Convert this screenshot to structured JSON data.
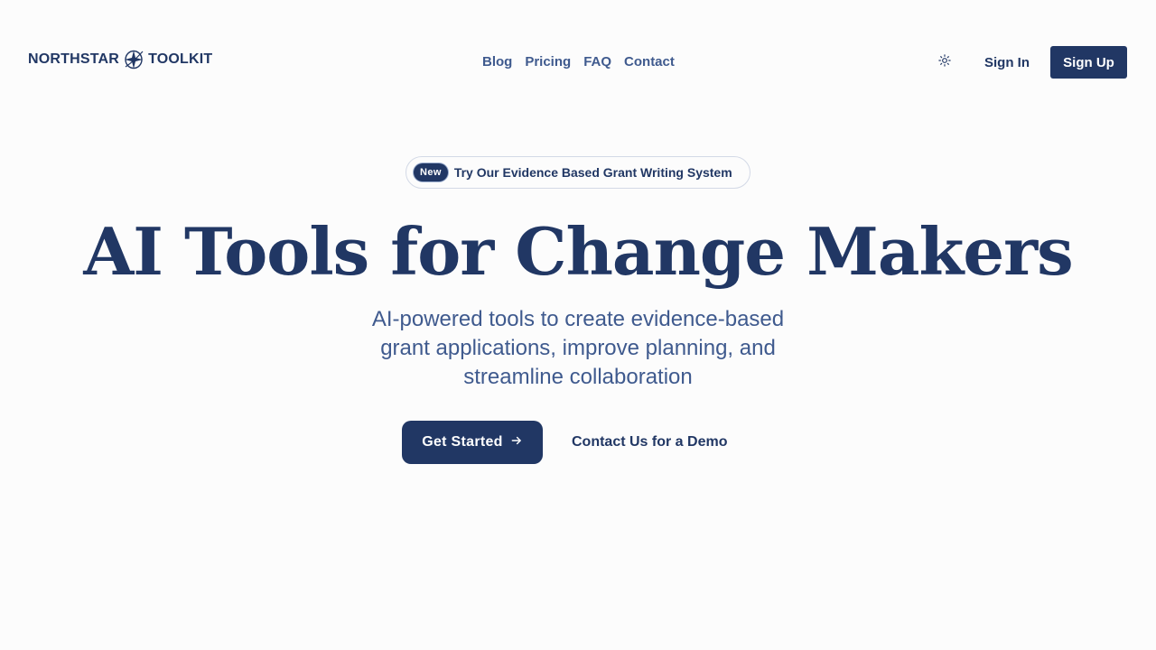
{
  "header": {
    "logo": {
      "left_text": "NORTHSTAR",
      "right_text": "TOOLKIT",
      "icon": "compass-star-icon"
    },
    "nav": [
      {
        "label": "Blog"
      },
      {
        "label": "Pricing"
      },
      {
        "label": "FAQ"
      },
      {
        "label": "Contact"
      }
    ],
    "theme_toggle_icon": "sun-icon",
    "sign_in_label": "Sign In",
    "sign_up_label": "Sign Up"
  },
  "announcement": {
    "badge": "New",
    "text": "Try Our Evidence Based Grant Writing System"
  },
  "hero": {
    "title": "AI Tools for Change Makers",
    "subtitle": "AI-powered tools to create evidence-based grant applications, improve planning, and streamline collaboration",
    "primary_cta": "Get Started",
    "primary_cta_icon": "arrow-right-icon",
    "secondary_cta": "Contact Us for a Demo"
  },
  "colors": {
    "brand": "#213764",
    "muted_text": "#3f5a8e",
    "background": "#fcfcfc",
    "pill_border": "#d3d9e6"
  }
}
